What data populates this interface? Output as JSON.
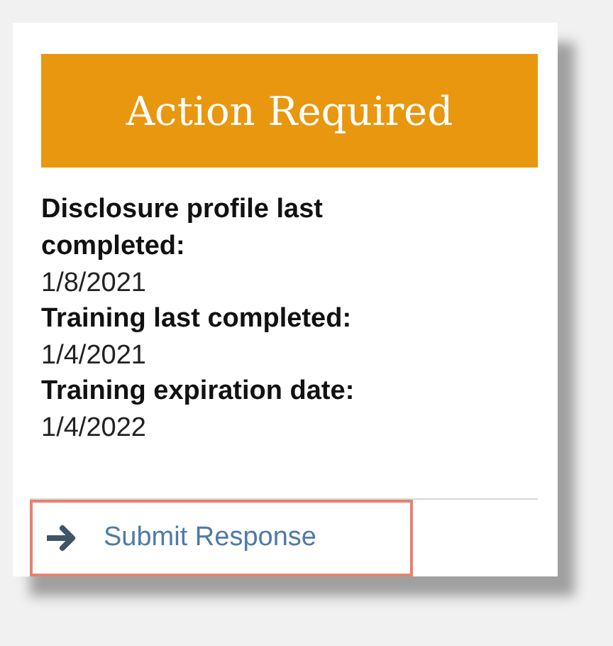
{
  "banner": {
    "title": "Action Required"
  },
  "fields": [
    {
      "label": "Disclosure profile last completed:",
      "value": "1/8/2021"
    },
    {
      "label": "Training last completed:",
      "value": "1/4/2021"
    },
    {
      "label": "Training expiration date:",
      "value": "1/4/2022"
    }
  ],
  "action": {
    "label": "Submit Response",
    "focused": true
  }
}
